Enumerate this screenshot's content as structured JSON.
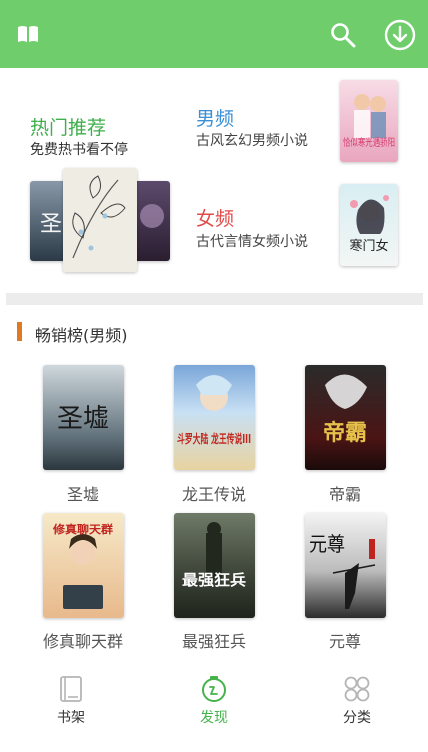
{
  "header": {
    "icons": {
      "left": "book-open-icon",
      "search": "search-icon",
      "download": "download-icon"
    },
    "color": "#6fcd6c"
  },
  "promo": {
    "hot": {
      "title": "热门推荐",
      "subtitle": "免费热书看不停"
    },
    "male": {
      "title": "男频",
      "subtitle": "古风玄幻男频小说",
      "cover_text": "恰似寒光遇骄阳"
    },
    "female": {
      "title": "女频",
      "subtitle": "古代言情女频小说",
      "cover_text": "寒门女"
    }
  },
  "section": {
    "title": "畅销榜(男频)"
  },
  "books": [
    {
      "title": "圣墟",
      "cover_text": "圣墟"
    },
    {
      "title": "龙王传说",
      "cover_text": "斗罗大陆 龙王传说III"
    },
    {
      "title": "帝霸",
      "cover_text": "帝霸"
    },
    {
      "title": "修真聊天群",
      "cover_text": "修真聊天群"
    },
    {
      "title": "最强狂兵",
      "cover_text": "最强狂兵"
    },
    {
      "title": "元尊",
      "cover_text": "元尊"
    }
  ],
  "tabs": [
    {
      "label": "书架",
      "icon": "bookshelf-icon",
      "active": false
    },
    {
      "label": "发现",
      "icon": "discover-icon",
      "active": true
    },
    {
      "label": "分类",
      "icon": "category-icon",
      "active": false
    }
  ],
  "colors": {
    "accent": "#3fae4b",
    "male": "#3a8fd6",
    "female": "#e04a48",
    "section_bar": "#e07a22"
  }
}
